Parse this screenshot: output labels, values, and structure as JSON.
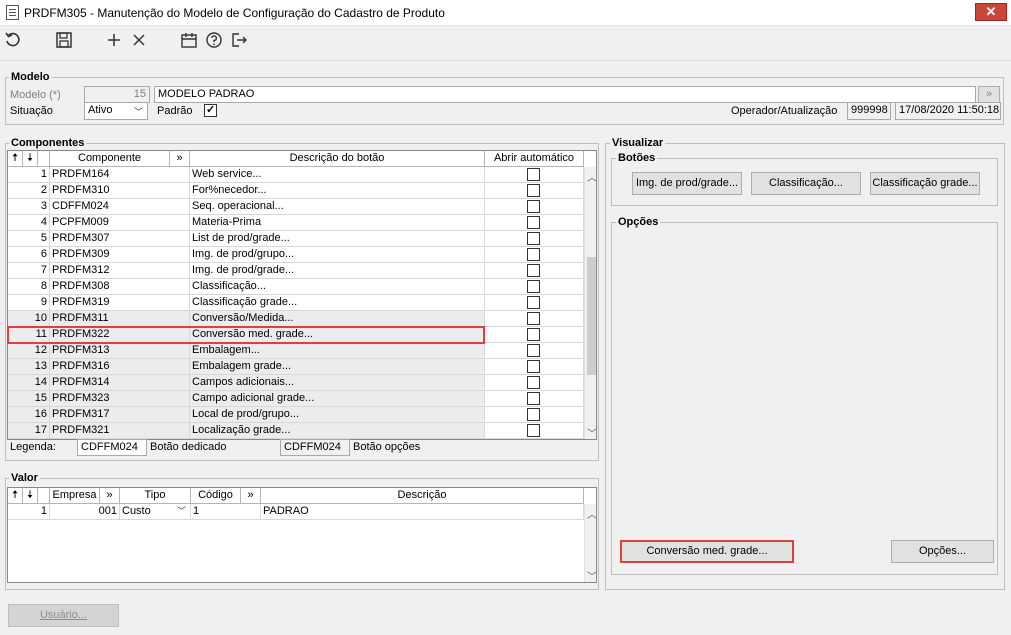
{
  "window": {
    "title": "PRDFM305 - Manutenção do Modelo de Configuração do Cadastro de Produto",
    "close_glyph": "✕"
  },
  "toolbar": {
    "icons": [
      "refresh-icon",
      "save-icon",
      "add-icon",
      "delete-icon",
      "calendar-icon",
      "help-icon",
      "exit-icon"
    ]
  },
  "modelo": {
    "group_label": "Modelo",
    "modelo_label": "Modelo (*)",
    "modelo_code": "15",
    "modelo_name": "MODELO PADRAO",
    "situacao_label": "Situação",
    "situacao_value": "Ativo",
    "padrao_label": "Padrão",
    "padrao_checked": true,
    "operador_label": "Operador/Atualização",
    "operador_value": "999998",
    "atualizacao_value": "17/08/2020 11:50:18"
  },
  "componentes": {
    "group_label": "Componentes",
    "headers": {
      "up": "🠅",
      "down": "🠇",
      "componente": "Componente",
      "expand": "»",
      "descricao": "Descrição do botão",
      "abrir": "Abrir automático"
    },
    "rows": [
      {
        "n": "1",
        "comp": "PRDFM164",
        "desc": "Web service..."
      },
      {
        "n": "2",
        "comp": "PRDFM310",
        "desc": "For%necedor..."
      },
      {
        "n": "3",
        "comp": "CDFFM024",
        "desc": "Seq. operacional..."
      },
      {
        "n": "4",
        "comp": "PCPFM009",
        "desc": "Materia-Prima"
      },
      {
        "n": "5",
        "comp": "PRDFM307",
        "desc": "List de prod/grade..."
      },
      {
        "n": "6",
        "comp": "PRDFM309",
        "desc": "Img. de prod/grupo..."
      },
      {
        "n": "7",
        "comp": "PRDFM312",
        "desc": "Img. de prod/grade..."
      },
      {
        "n": "8",
        "comp": "PRDFM308",
        "desc": "Classificação..."
      },
      {
        "n": "9",
        "comp": "PRDFM319",
        "desc": "Classificação grade..."
      },
      {
        "n": "10",
        "comp": "PRDFM311",
        "desc": "Conversão/Medida..."
      },
      {
        "n": "11",
        "comp": "PRDFM322",
        "desc": "Conversão med. grade..."
      },
      {
        "n": "12",
        "comp": "PRDFM313",
        "desc": "Embalagem..."
      },
      {
        "n": "13",
        "comp": "PRDFM316",
        "desc": "Embalagem grade..."
      },
      {
        "n": "14",
        "comp": "PRDFM314",
        "desc": "Campos adicionais..."
      },
      {
        "n": "15",
        "comp": "PRDFM323",
        "desc": "Campo adicional grade..."
      },
      {
        "n": "16",
        "comp": "PRDFM317",
        "desc": "Local de prod/grupo..."
      },
      {
        "n": "17",
        "comp": "PRDFM321",
        "desc": "Localização grade..."
      }
    ],
    "legenda_label": "Legenda:",
    "legenda_dedicado_code": "CDFFM024",
    "legenda_dedicado_text": "Botão dedicado",
    "legenda_opcoes_code": "CDFFM024",
    "legenda_opcoes_text": "Botão opções"
  },
  "valor": {
    "group_label": "Valor",
    "headers": {
      "up": "🠅",
      "down": "🠇",
      "empresa": "Empresa",
      "expand1": "»",
      "tipo": "Tipo",
      "codigo": "Código",
      "expand2": "»",
      "descricao": "Descrição"
    },
    "row": {
      "n": "1",
      "empresa": "001",
      "tipo": "Custo",
      "codigo": "1",
      "descricao": "PADRAO"
    }
  },
  "visualizar": {
    "group_label": "Visualizar",
    "botoes_label": "Botões",
    "botoes": [
      "Img. de prod/grade...",
      "Classificação...",
      "Classificação grade..."
    ],
    "opcoes_label": "Opções",
    "conversao_button": "Conversão med. grade...",
    "opcoes_button": "Opções..."
  },
  "footer": {
    "usuario_button": "Usuário..."
  },
  "colors": {
    "highlight": "#e0403a",
    "alt_row": "#ececec",
    "close_button": "#c9463d"
  }
}
